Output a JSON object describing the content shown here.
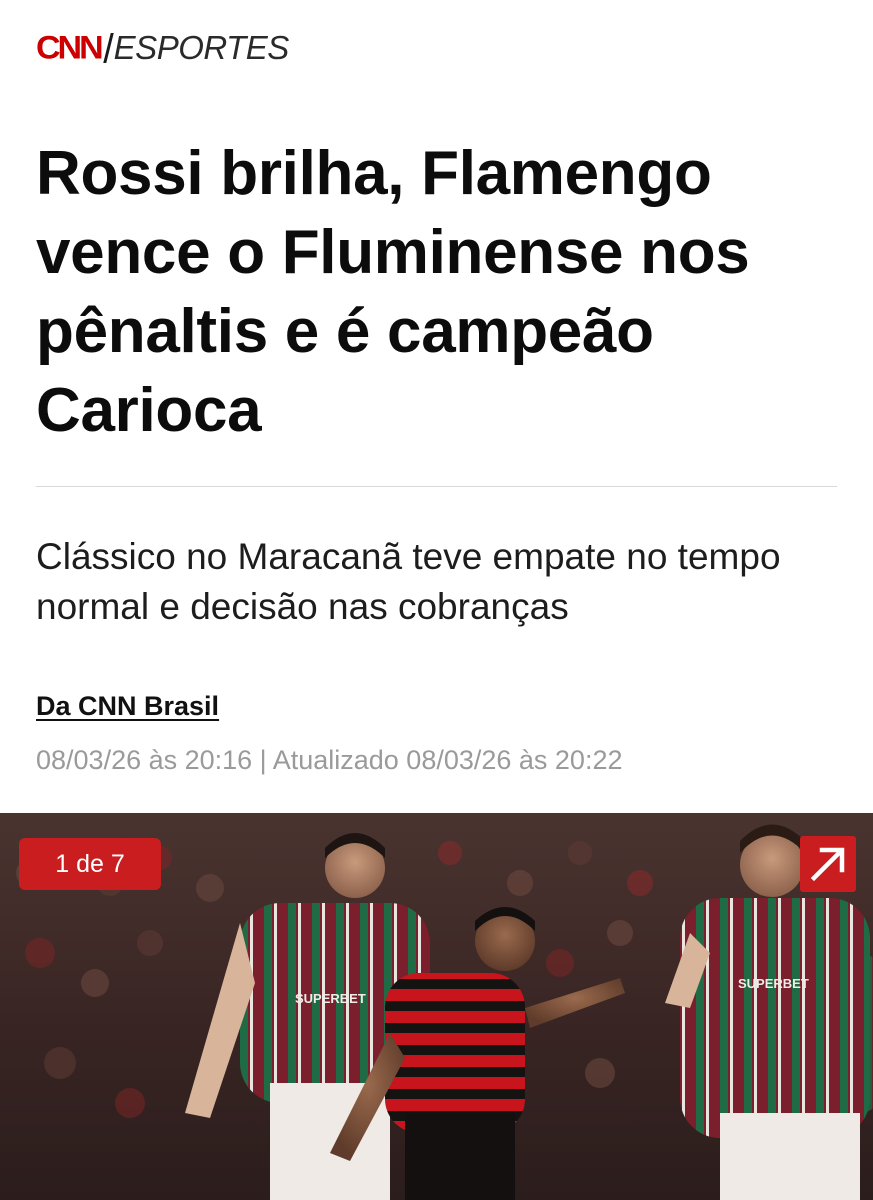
{
  "brand": {
    "logo_text": "CNN",
    "section": "ESPORTES",
    "logo_color": "#cc0000"
  },
  "article": {
    "headline": "Rossi brilha, Flamengo vence o Fluminense nos pênaltis e é campeão Carioca",
    "subheadline": "Clássico no Maracanã teve empate no tempo normal e decisão nas cobranças",
    "byline": "Da CNN Brasil",
    "timestamp": "08/03/26 às 20:16 | Atualizado 08/03/26 às 20:22"
  },
  "gallery": {
    "counter": "1 de 7",
    "current": 1,
    "total": 7,
    "expand_icon": "arrow-up-right-icon",
    "jersey_text": "SUPERBET",
    "accent_color": "#c91d1f"
  }
}
